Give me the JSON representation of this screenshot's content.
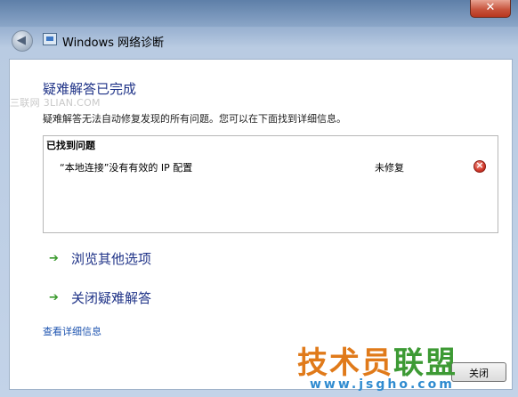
{
  "window": {
    "title": "Windows 网络诊断",
    "close_label": "✕"
  },
  "main": {
    "heading": "疑难解答已完成",
    "watermark": "三联网 3LIAN.COM",
    "description": "疑难解答无法自动修复发现的所有问题。您可以在下面找到详细信息。",
    "problems": {
      "header": "已找到问题",
      "items": [
        {
          "name": "“本地连接”没有有效的 IP 配置",
          "status": "未修复",
          "status_icon": "error-icon"
        }
      ]
    },
    "options": [
      {
        "label": "浏览其他选项",
        "icon": "green-arrow-icon"
      },
      {
        "label": "关闭疑难解答",
        "icon": "green-arrow-icon"
      }
    ],
    "details_link": "查看详细信息",
    "footer_button": "关闭"
  },
  "brand_watermark": {
    "part1": "技术员",
    "part2": "联盟",
    "url": "www.jsgho.com"
  },
  "colors": {
    "heading": "#1e3287",
    "link": "#1f55b0",
    "arrow": "#3a9a2d",
    "error": "#d2392b"
  }
}
